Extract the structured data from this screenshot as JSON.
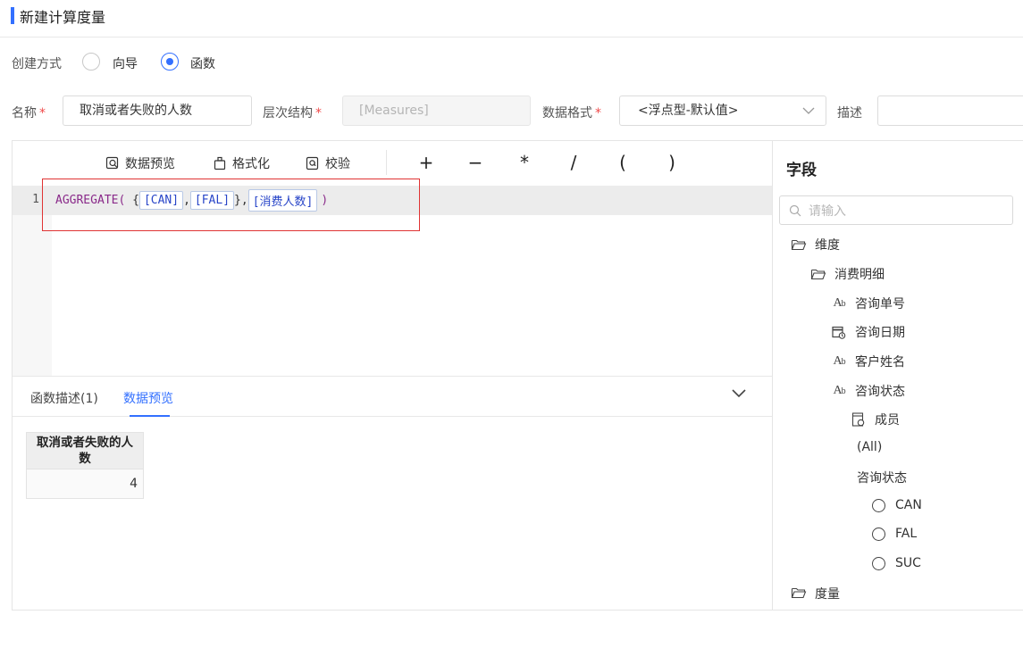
{
  "page": {
    "title": "新建计算度量"
  },
  "creation": {
    "label": "创建方式",
    "options": [
      {
        "label": "向导",
        "checked": false
      },
      {
        "label": "函数",
        "checked": true
      }
    ]
  },
  "form": {
    "name_label": "名称",
    "name_value": "取消或者失败的人数",
    "hierarchy_label": "层次结构",
    "hierarchy_value": "[Measures]",
    "format_label": "数据格式",
    "format_value": "<浮点型-默认值>",
    "desc_label": "描述",
    "desc_value": "",
    "required_mark": "*"
  },
  "toolbar": {
    "preview_label": "数据预览",
    "format_label": "格式化",
    "validate_label": "校验",
    "operators": [
      "+",
      "−",
      "*",
      "/",
      "(",
      ")"
    ]
  },
  "editor": {
    "line_number": "1",
    "function_name": "AGGREGATE(",
    "brace_open": " {",
    "token_1": "[CAN]",
    "comma_1": ",",
    "token_2": "[FAL]",
    "brace_close": "},",
    "token_3": "[消费人数]",
    "paren_close": ")"
  },
  "bottom": {
    "tabs": [
      {
        "label": "函数描述(1)",
        "active": false
      },
      {
        "label": "数据预览",
        "active": true
      }
    ],
    "preview_table": {
      "header": "取消或者失败的人数",
      "value": "4"
    }
  },
  "fields": {
    "title": "字段",
    "search_placeholder": "请输入",
    "dimension_label": "维度",
    "table_label": "消费明细",
    "field_1": "咨询单号",
    "field_2": "咨询日期",
    "field_3": "客户姓名",
    "field_4": "咨询状态",
    "member_label": "成员",
    "all_label": "(All)",
    "level_label": "咨询状态",
    "member_1": "CAN",
    "member_2": "FAL",
    "member_3": "SUC",
    "measure_label": "度量"
  },
  "colors": {
    "accent": "#3370ff",
    "required": "#f04a4a",
    "highlight_box": "#e03333"
  }
}
